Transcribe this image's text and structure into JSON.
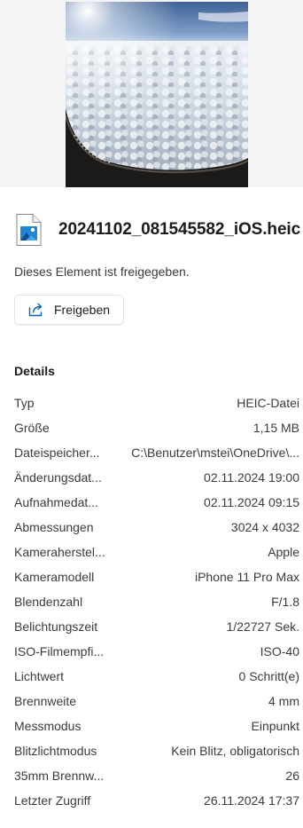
{
  "file": {
    "name": "20241102_081545582_iOS.heic",
    "shared_status": "Dieses Element ist freigegeben."
  },
  "share_button": {
    "label": "Freigeben",
    "icon": "share-icon"
  },
  "details": {
    "title": "Details",
    "rows": [
      {
        "label": "Typ",
        "value": "HEIC-Datei"
      },
      {
        "label": "Größe",
        "value": "1,15 MB"
      },
      {
        "label": "Dateispeicher...",
        "value": "C:\\Benutzer\\mstei\\OneDrive\\..."
      },
      {
        "label": "Änderungsdat...",
        "value": "02.11.2024 19:00"
      },
      {
        "label": "Aufnahmedat...",
        "value": "02.11.2024 09:15"
      },
      {
        "label": "Abmessungen",
        "value": "3024 x 4032"
      },
      {
        "label": "Kameraherstel...",
        "value": "Apple"
      },
      {
        "label": "Kameramodell",
        "value": "iPhone 11 Pro Max"
      },
      {
        "label": "Blendenzahl",
        "value": "F/1.8"
      },
      {
        "label": "Belichtungszeit",
        "value": "1/22727 Sek."
      },
      {
        "label": "ISO-Filmempfi...",
        "value": "ISO-40"
      },
      {
        "label": "Lichtwert",
        "value": "0 Schritt(e)"
      },
      {
        "label": "Brennweite",
        "value": "4 mm"
      },
      {
        "label": "Messmodus",
        "value": "Einpunkt"
      },
      {
        "label": "Blitzlichtmodus",
        "value": "Kein Blitz, obligatorisch"
      },
      {
        "label": "35mm Brennw...",
        "value": "26"
      },
      {
        "label": "Letzter Zugriff",
        "value": "26.11.2024 17:37"
      }
    ]
  },
  "colors": {
    "accent": "#005fb8",
    "preview_background": "#f5f5f5",
    "text": "#1b1b1b"
  }
}
